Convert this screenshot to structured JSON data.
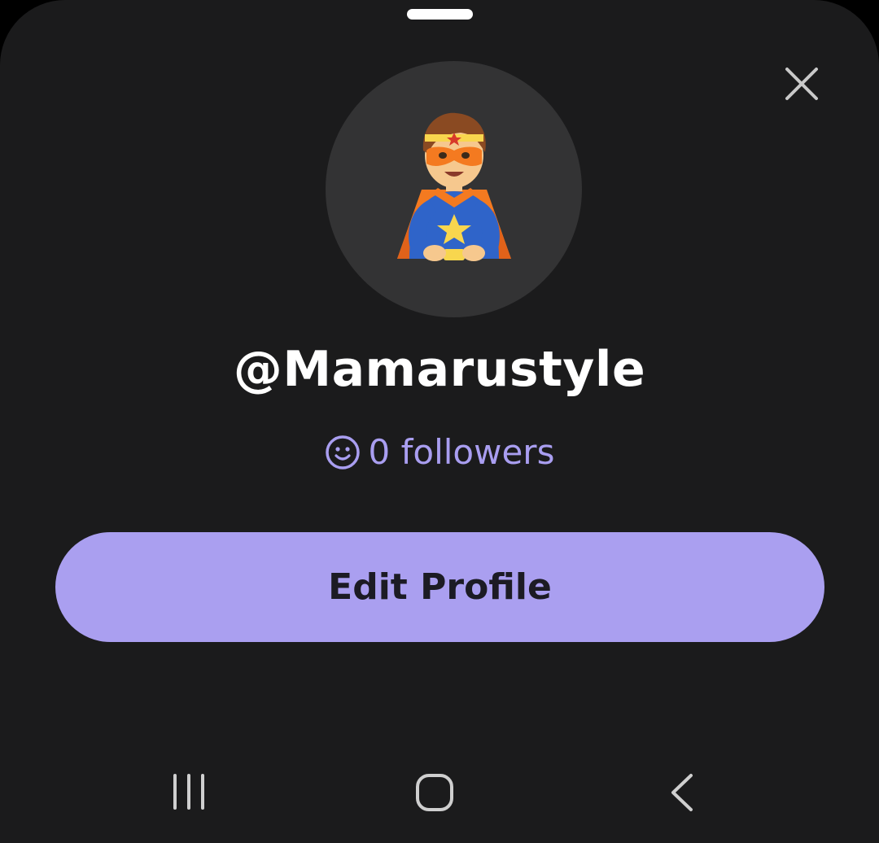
{
  "profile": {
    "username": "@Mamarustyle",
    "followers_text": "0 followers",
    "avatar_icon": "superhero-emoji"
  },
  "actions": {
    "edit_profile_label": "Edit Profile",
    "close_icon": "close-icon"
  },
  "navbar": {
    "recents_icon": "recents-icon",
    "home_icon": "home-icon",
    "back_icon": "back-icon"
  },
  "colors": {
    "background": "#1b1b1c",
    "avatar_bg": "#333334",
    "accent": "#aa9ff0",
    "followers_text": "#a99ef0",
    "button_text": "#1c1b24"
  }
}
